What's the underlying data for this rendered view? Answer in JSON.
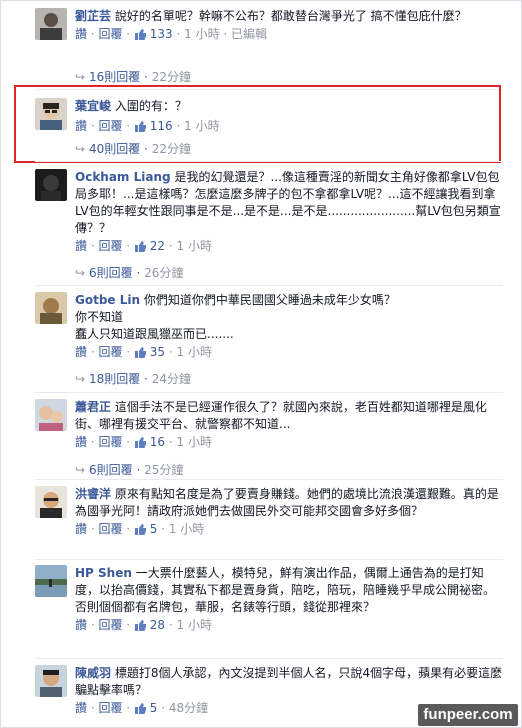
{
  "comments": [
    {
      "author": "劉芷芸",
      "text": "說好的名單呢？幹嘛不公布？都敢替台灣爭光了 搞不懂包庇什麼？",
      "read_label": "讚",
      "reply_label": "回覆",
      "likes": "133",
      "time": "1 小時",
      "edited": "已編輯",
      "replies": "16則回覆",
      "replies_time": "22分鐘"
    },
    {
      "author": "葉宜峻",
      "text": "入圍的有：？",
      "read_label": "讚",
      "reply_label": "回覆",
      "likes": "116",
      "time": "1 小時",
      "replies": "40則回覆",
      "replies_time": "22分鐘"
    },
    {
      "author": "Ockham Liang",
      "text": "是我的幻覺還是？...像這種賣淫的新聞女主角好像都拿LV包包局多耶！...是這樣嗎？怎麼這麼多牌子的包不拿都拿LV呢？...這不經讓我看到拿LV包的年輕女性跟同事是不是...是不是...是不是.......................幫LV包包另類宣傳？？",
      "read_label": "讚",
      "reply_label": "回覆",
      "likes": "22",
      "time": "1 小時",
      "replies": "6則回覆",
      "replies_time": "26分鐘"
    },
    {
      "author": "Gotbe Lin",
      "text": "你們知道你們中華民國國父睡過未成年少女嗎？",
      "text2": "你不知道",
      "text3": "蠢人只知道跟風獵巫而已.......",
      "read_label": "讚",
      "reply_label": "回覆",
      "likes": "35",
      "time": "1 小時",
      "replies": "18則回覆",
      "replies_time": "24分鐘"
    },
    {
      "author": "蕭君正",
      "text": "這個手法不是已經運作很久了？就國內來說，老百姓都知道哪裡是風化街、哪裡有援交平台、就警察都不知道...",
      "read_label": "讚",
      "reply_label": "回覆",
      "likes": "16",
      "time": "1 小時",
      "replies": "6則回覆",
      "replies_time": "25分鐘"
    },
    {
      "author": "洪睿洋",
      "text": "原來有點知名度是為了要賣身賺錢。她們的處境比流浪漢還艱難。真的是為國爭光阿！請政府派她們去做國民外交可能邦交國會多好多個？",
      "read_label": "讚",
      "reply_label": "回覆",
      "likes": "5",
      "time": "1 小時"
    },
    {
      "author": "HP Shen",
      "text": "一大票什麼藝人，模特兒，鮮有演出作品，偶爾上通告為的是打知度，以抬高價錢，其實私下都是賣身貨，陪吃，陪玩，陪睡幾乎早成公開祕密。否則個個都有名牌包，華服，名錶等行頭，錢從那裡來？",
      "read_label": "讚",
      "reply_label": "回覆",
      "likes": "28",
      "time": "1 小時"
    },
    {
      "author": "陳威羽",
      "text": "標題打8個人承認，內文沒提到半個人名，只說4個字母，蘋果有必要這麼騙點擊率嗎？",
      "read_label": "讚",
      "reply_label": "回覆",
      "likes": "5",
      "time": "48分鐘"
    }
  ],
  "watermark": "funpeer.com",
  "colors": {
    "link": "#3b5998",
    "meta": "#9197a3",
    "highlight": "#e0242a"
  }
}
